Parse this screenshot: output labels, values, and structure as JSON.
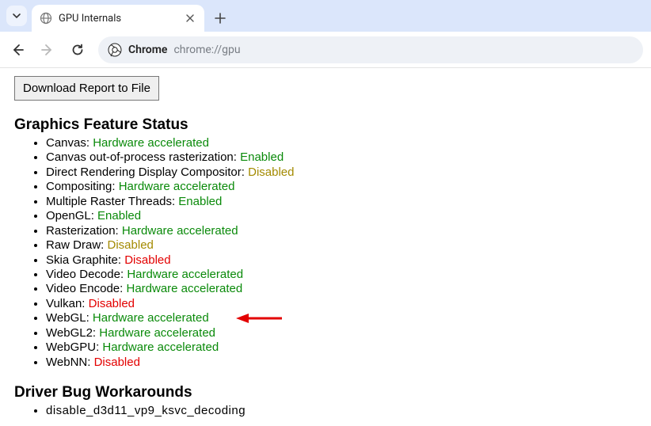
{
  "tab": {
    "title": "GPU Internals"
  },
  "address": {
    "scheme_label": "Chrome",
    "url": "chrome://gpu"
  },
  "content": {
    "download_button": "Download Report to File",
    "feature_heading": "Graphics Feature Status",
    "features": [
      {
        "name": "Canvas",
        "status": "Hardware accelerated",
        "cls": "status-green"
      },
      {
        "name": "Canvas out-of-process rasterization",
        "status": "Enabled",
        "cls": "status-green"
      },
      {
        "name": "Direct Rendering Display Compositor",
        "status": "Disabled",
        "cls": "status-darkyellow"
      },
      {
        "name": "Compositing",
        "status": "Hardware accelerated",
        "cls": "status-green"
      },
      {
        "name": "Multiple Raster Threads",
        "status": "Enabled",
        "cls": "status-green"
      },
      {
        "name": "OpenGL",
        "status": "Enabled",
        "cls": "status-green"
      },
      {
        "name": "Rasterization",
        "status": "Hardware accelerated",
        "cls": "status-green"
      },
      {
        "name": "Raw Draw",
        "status": "Disabled",
        "cls": "status-darkyellow"
      },
      {
        "name": "Skia Graphite",
        "status": "Disabled",
        "cls": "status-red"
      },
      {
        "name": "Video Decode",
        "status": "Hardware accelerated",
        "cls": "status-green"
      },
      {
        "name": "Video Encode",
        "status": "Hardware accelerated",
        "cls": "status-green"
      },
      {
        "name": "Vulkan",
        "status": "Disabled",
        "cls": "status-red"
      },
      {
        "name": "WebGL",
        "status": "Hardware accelerated",
        "cls": "status-green",
        "highlight": true
      },
      {
        "name": "WebGL2",
        "status": "Hardware accelerated",
        "cls": "status-green"
      },
      {
        "name": "WebGPU",
        "status": "Hardware accelerated",
        "cls": "status-green"
      },
      {
        "name": "WebNN",
        "status": "Disabled",
        "cls": "status-red"
      }
    ],
    "workaround_heading": "Driver Bug Workarounds",
    "workarounds": [
      "disable_d3d11_vp9_ksvc_decoding"
    ]
  }
}
